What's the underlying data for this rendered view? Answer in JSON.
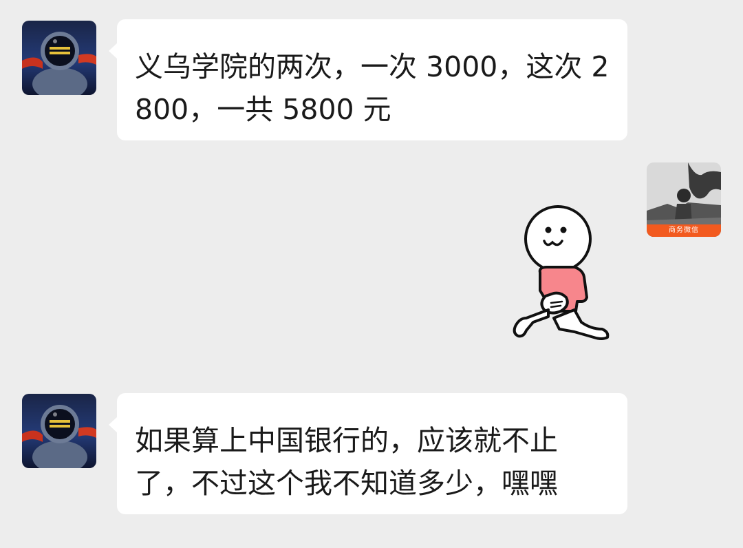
{
  "messages": [
    {
      "sender": "contact",
      "text": "义乌学院的两次，一次 3000，这次 2800，一共 5800 元"
    },
    {
      "sender": "self",
      "type": "sticker",
      "sticker_icon": "kneeling-smiley-sticker"
    },
    {
      "sender": "contact",
      "text": "如果算上中国银行的，应该就不止了，不过这个我不知道多少，嘿嘿"
    }
  ],
  "self_avatar": {
    "tag": "商务微信"
  },
  "colors": {
    "background": "#ededed",
    "bubble": "#ffffff",
    "text": "#1a1a1a",
    "sticker_shirt": "#f7868c",
    "avatar_tag": "#f25a1f"
  }
}
